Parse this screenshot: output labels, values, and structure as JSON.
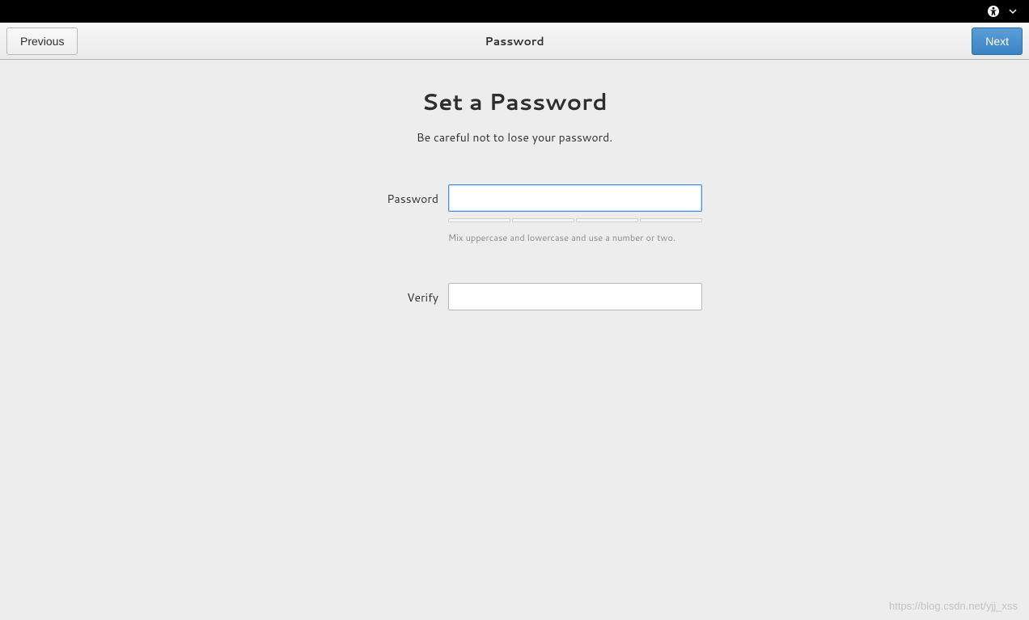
{
  "topbar": {
    "accessibility_icon": "accessibility",
    "menu_arrow": "▾"
  },
  "header": {
    "title": "Password",
    "previous_label": "Previous",
    "next_label": "Next"
  },
  "main": {
    "title": "Set a Password",
    "subtitle": "Be careful not to lose your password.",
    "password_label": "Password",
    "password_value": "",
    "hint": "Mix uppercase and lowercase and use a number or two.",
    "verify_label": "Verify",
    "verify_value": ""
  },
  "watermark": "https://blog.csdn.net/yjj_xss"
}
